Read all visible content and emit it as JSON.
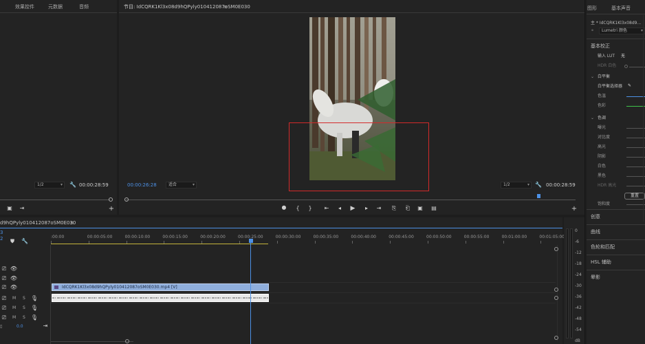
{
  "source_panel": {
    "tabs": [
      "效果控件",
      "元数据",
      "音频"
    ],
    "zoom": "1/2",
    "timecode": "00:00:28:59"
  },
  "program_panel": {
    "title": "节目: IdCQRK1Kl3x08d9hQPyly010412087oSM0E030",
    "timecode_left": "00:00:26:28",
    "fit": "适合",
    "zoom": "1/2",
    "timecode_right": "00:00:28:59"
  },
  "timeline": {
    "sequence_name": "d9hQPyly010412087oSM0E030",
    "playhead_time": "3",
    "sub_time": "2",
    "ruler_labels": [
      ":00:00",
      "00:00:05:00",
      "00:00:10:00",
      "00:00:15:00",
      "00:00:20:00",
      "00:00:25:00",
      "00:00:30:00",
      "00:00:35:00",
      "00:00:40:00",
      "00:00:45:00",
      "00:00:50:00",
      "00:00:55:00",
      "00:01:00:00",
      "00:01:05:00"
    ],
    "video_clip_label": "IdCQRK1Kl3x08d9hQPyly010412087oSM0E030.mp4 [V]",
    "track_m": "M",
    "track_s": "S",
    "volume": "0.0"
  },
  "meter_labels": [
    "0",
    "-6",
    "-12",
    "-18",
    "-24",
    "-30",
    "-36",
    "-42",
    "-48",
    "-54"
  ],
  "meter_ds": "dB",
  "lumetri": {
    "tabs": [
      "图形",
      "基本声音"
    ],
    "master_clip": "主 * IdCQRK1Kl3x08d9...",
    "effect": "Lumetri 颜色",
    "basic_correction": "基本校正",
    "input_lut_label": "输入 LUT",
    "input_lut_value": "无",
    "hdr_white": "HDR 白色",
    "white_balance": "白平衡",
    "wb_selector": "白平衡选择器",
    "temperature": "色温",
    "tint": "色彩",
    "tone": "色调",
    "tone_items": [
      "曝光",
      "对比度",
      "高光",
      "阴影",
      "白色",
      "黑色",
      "HDR 高光"
    ],
    "reset_button": "重置",
    "saturation": "饱和度",
    "sections": [
      "创意",
      "曲线",
      "色轮和匹配",
      "HSL 辅助",
      "晕影"
    ]
  },
  "accent_blue": "#4d91e6",
  "red_box": "#d42a2a"
}
